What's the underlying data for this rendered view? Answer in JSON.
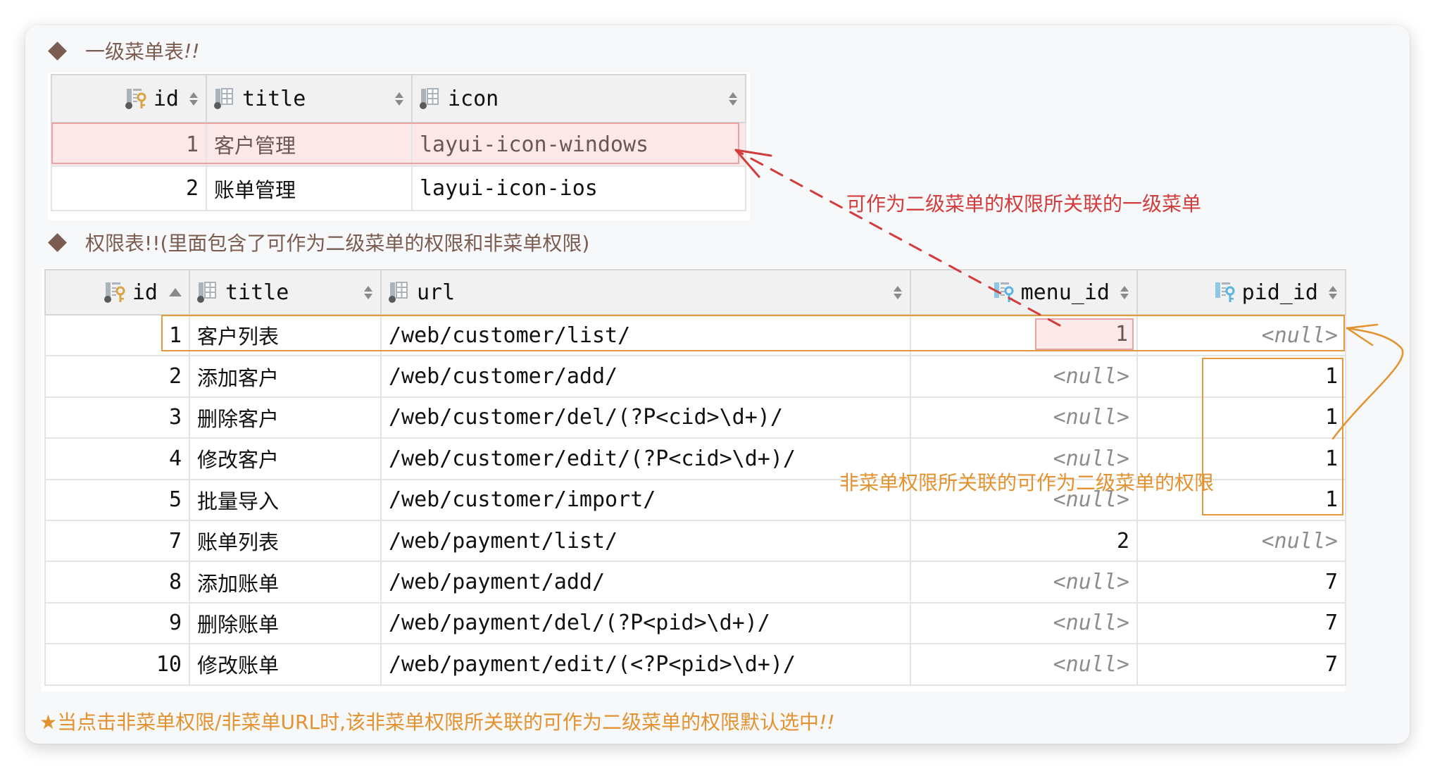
{
  "section1": {
    "heading": "一级菜单表",
    "heading_suffix": "!!",
    "columns": [
      {
        "name": "id",
        "icon": "primary-key-column-icon",
        "sort": "both"
      },
      {
        "name": "title",
        "icon": "column-icon",
        "sort": "both"
      },
      {
        "name": "icon",
        "icon": "column-icon",
        "sort": "both"
      }
    ],
    "rows": [
      {
        "id": "1",
        "title": "客户管理",
        "icon": "layui-icon-windows",
        "highlighted": true
      },
      {
        "id": "2",
        "title": "账单管理",
        "icon": "layui-icon-ios",
        "highlighted": false
      }
    ]
  },
  "section2": {
    "heading": "权限表!!(里面包含了可作为二级菜单的权限和非菜单权限)",
    "columns": [
      {
        "name": "id",
        "icon": "primary-key-column-icon",
        "sort": "ascending"
      },
      {
        "name": "title",
        "icon": "column-icon",
        "sort": "both"
      },
      {
        "name": "url",
        "icon": "column-icon",
        "sort": "both"
      },
      {
        "name": "menu_id",
        "icon": "foreign-key-column-icon",
        "sort": "both"
      },
      {
        "name": "pid_id",
        "icon": "foreign-key-column-icon",
        "sort": "both"
      }
    ],
    "null_text": "<null>",
    "rows": [
      {
        "id": "1",
        "title": "客户列表",
        "url": "/web/customer/list/",
        "menu_id": "1",
        "pid_id": null
      },
      {
        "id": "2",
        "title": "添加客户",
        "url": "/web/customer/add/",
        "menu_id": null,
        "pid_id": "1"
      },
      {
        "id": "3",
        "title": "删除客户",
        "url": "/web/customer/del/(?P<cid>\\d+)/",
        "menu_id": null,
        "pid_id": "1"
      },
      {
        "id": "4",
        "title": "修改客户",
        "url": "/web/customer/edit/(?P<cid>\\d+)/",
        "menu_id": null,
        "pid_id": "1"
      },
      {
        "id": "5",
        "title": "批量导入",
        "url": "/web/customer/import/",
        "menu_id": null,
        "pid_id": "1"
      },
      {
        "id": "7",
        "title": "账单列表",
        "url": "/web/payment/list/",
        "menu_id": "2",
        "pid_id": null
      },
      {
        "id": "8",
        "title": "添加账单",
        "url": "/web/payment/add/",
        "menu_id": null,
        "pid_id": "7"
      },
      {
        "id": "9",
        "title": "删除账单",
        "url": "/web/payment/del/(?P<pid>\\d+)/",
        "menu_id": null,
        "pid_id": "7"
      },
      {
        "id": "10",
        "title": "修改账单",
        "url": "/web/payment/edit/(<?P<pid>\\d+)/",
        "menu_id": null,
        "pid_id": "7"
      }
    ]
  },
  "annotations": {
    "menu_link": "可作为二级菜单的权限所关联的一级菜单",
    "pid_link": "非菜单权限所关联的可作为二级菜单的权限"
  },
  "footer": {
    "star": "★",
    "text": "当点击非菜单权限/非菜单URL时,该非菜单权限所关联的可作为二级菜单的权限默认选中",
    "suffix": "!!"
  },
  "colors": {
    "heading": "#7a5c50",
    "annotation_red": "#d23c3c",
    "annotation_orange": "#e3922f",
    "highlight_pink": "#fce8e8",
    "primary_key": "#d9a441",
    "foreign_key": "#5bb4e0"
  }
}
